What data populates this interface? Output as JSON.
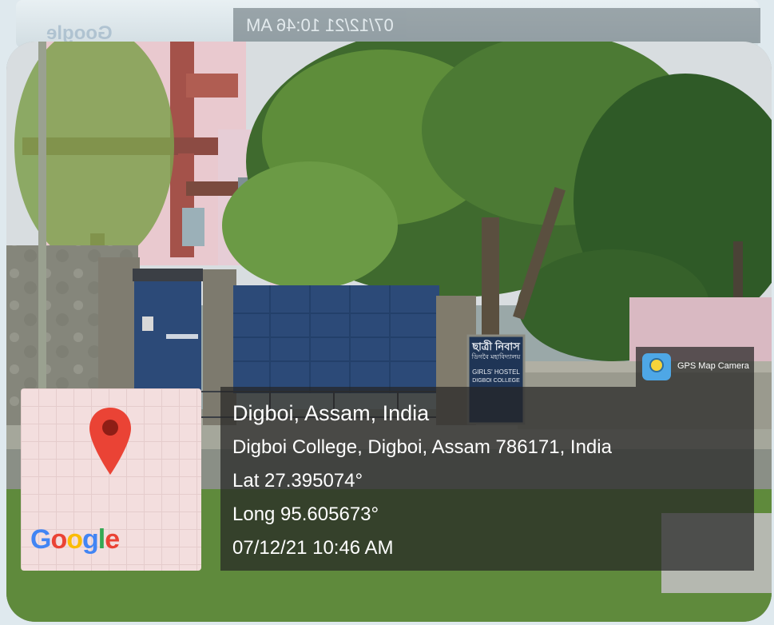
{
  "watermark": {
    "google_mirrored": "Google",
    "datetime_mirrored": "07/12/21 10:46 AM"
  },
  "photo": {
    "sign_line1": "ছাত্ৰী নিবাস",
    "sign_line2": "ডিগবৈ মহাবিদ্যালয়",
    "sign_line3": "GIRLS' HOSTEL",
    "sign_line4": "DIGBOI COLLEGE"
  },
  "map": {
    "logo": {
      "G": "G",
      "o1": "o",
      "o2": "o",
      "g": "g",
      "l": "l",
      "e": "e"
    }
  },
  "app_badge": {
    "label": "GPS Map Camera",
    "icon": "gps-map-camera-icon"
  },
  "location": {
    "place": "Digboi, Assam, India",
    "address": "Digboi College, Digboi, Assam 786171, India",
    "latitude": "Lat 27.395074°",
    "longitude": "Long 95.605673°",
    "datetime": "07/12/21 10:46 AM"
  },
  "colors": {
    "gate": "#2c4a78",
    "pin": "#ea4335",
    "panel": "#262626"
  }
}
